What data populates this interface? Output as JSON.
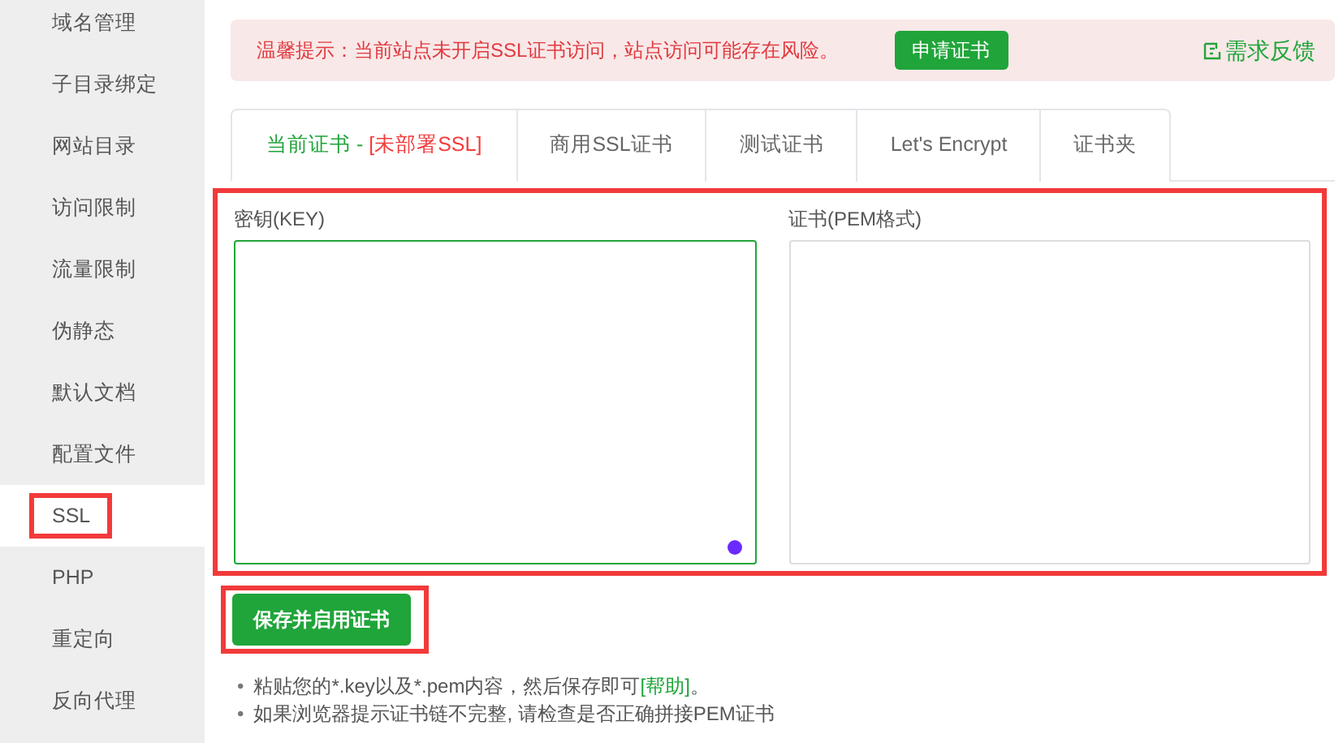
{
  "sidebar": {
    "items": [
      {
        "label": "域名管理",
        "selected": false,
        "highlighted": false
      },
      {
        "label": "子目录绑定",
        "selected": false,
        "highlighted": false
      },
      {
        "label": "网站目录",
        "selected": false,
        "highlighted": false
      },
      {
        "label": "访问限制",
        "selected": false,
        "highlighted": false
      },
      {
        "label": "流量限制",
        "selected": false,
        "highlighted": false
      },
      {
        "label": "伪静态",
        "selected": false,
        "highlighted": false
      },
      {
        "label": "默认文档",
        "selected": false,
        "highlighted": false
      },
      {
        "label": "配置文件",
        "selected": false,
        "highlighted": false
      },
      {
        "label": "SSL",
        "selected": true,
        "highlighted": true
      },
      {
        "label": "PHP",
        "selected": false,
        "highlighted": false
      },
      {
        "label": "重定向",
        "selected": false,
        "highlighted": false
      },
      {
        "label": "反向代理",
        "selected": false,
        "highlighted": false
      }
    ]
  },
  "alert": {
    "text": "温馨提示：当前站点未开启SSL证书访问，站点访问可能存在风险。",
    "button": "申请证书",
    "feedback_link": "需求反馈"
  },
  "tabs": [
    {
      "label": "当前证书 - ",
      "status": "[未部署SSL]",
      "selected": true
    },
    {
      "label": "商用SSL证书",
      "selected": false
    },
    {
      "label": "测试证书",
      "selected": false
    },
    {
      "label": "Let's Encrypt",
      "selected": false
    },
    {
      "label": "证书夹",
      "selected": false
    }
  ],
  "form": {
    "highlighted": true,
    "key_field": {
      "label": "密钥(KEY)",
      "focused": true
    },
    "cert_field": {
      "label": "证书(PEM格式)",
      "focused": false
    }
  },
  "save_button": {
    "label": "保存并启用证书",
    "highlighted": true
  },
  "notes": [
    {
      "marker": "•",
      "text": "粘贴您的*.key以及*.pem内容，然后保存即可",
      "link": "[帮助]",
      "end": "。"
    },
    {
      "marker": "•",
      "text": "如果浏览器提示证书链不完整, 请检查是否正确拼接PEM证书"
    }
  ]
}
